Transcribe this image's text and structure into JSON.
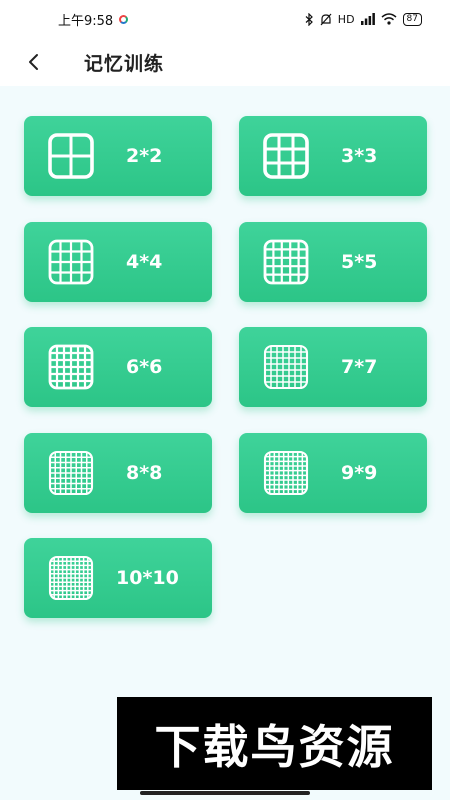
{
  "status_bar": {
    "time": "上午9:58",
    "network": "HD",
    "battery": "87"
  },
  "header": {
    "back_icon": "chevron-left-icon",
    "title": "记忆训练"
  },
  "colors": {
    "card_green": "#34cc8f",
    "background": "#f2fbfd",
    "card_text": "#ffffff"
  },
  "grid_options": [
    {
      "label": "2*2",
      "size": 2,
      "icon": "grid-2x2-icon"
    },
    {
      "label": "3*3",
      "size": 3,
      "icon": "grid-3x3-icon"
    },
    {
      "label": "4*4",
      "size": 4,
      "icon": "grid-4x4-icon"
    },
    {
      "label": "5*5",
      "size": 5,
      "icon": "grid-5x5-icon"
    },
    {
      "label": "6*6",
      "size": 6,
      "icon": "grid-6x6-icon"
    },
    {
      "label": "7*7",
      "size": 7,
      "icon": "grid-7x7-icon"
    },
    {
      "label": "8*8",
      "size": 8,
      "icon": "grid-8x8-icon"
    },
    {
      "label": "9*9",
      "size": 9,
      "icon": "grid-9x9-icon"
    },
    {
      "label": "10*10",
      "size": 10,
      "icon": "grid-10x10-icon"
    }
  ],
  "watermark": {
    "text": "下载鸟资源"
  }
}
